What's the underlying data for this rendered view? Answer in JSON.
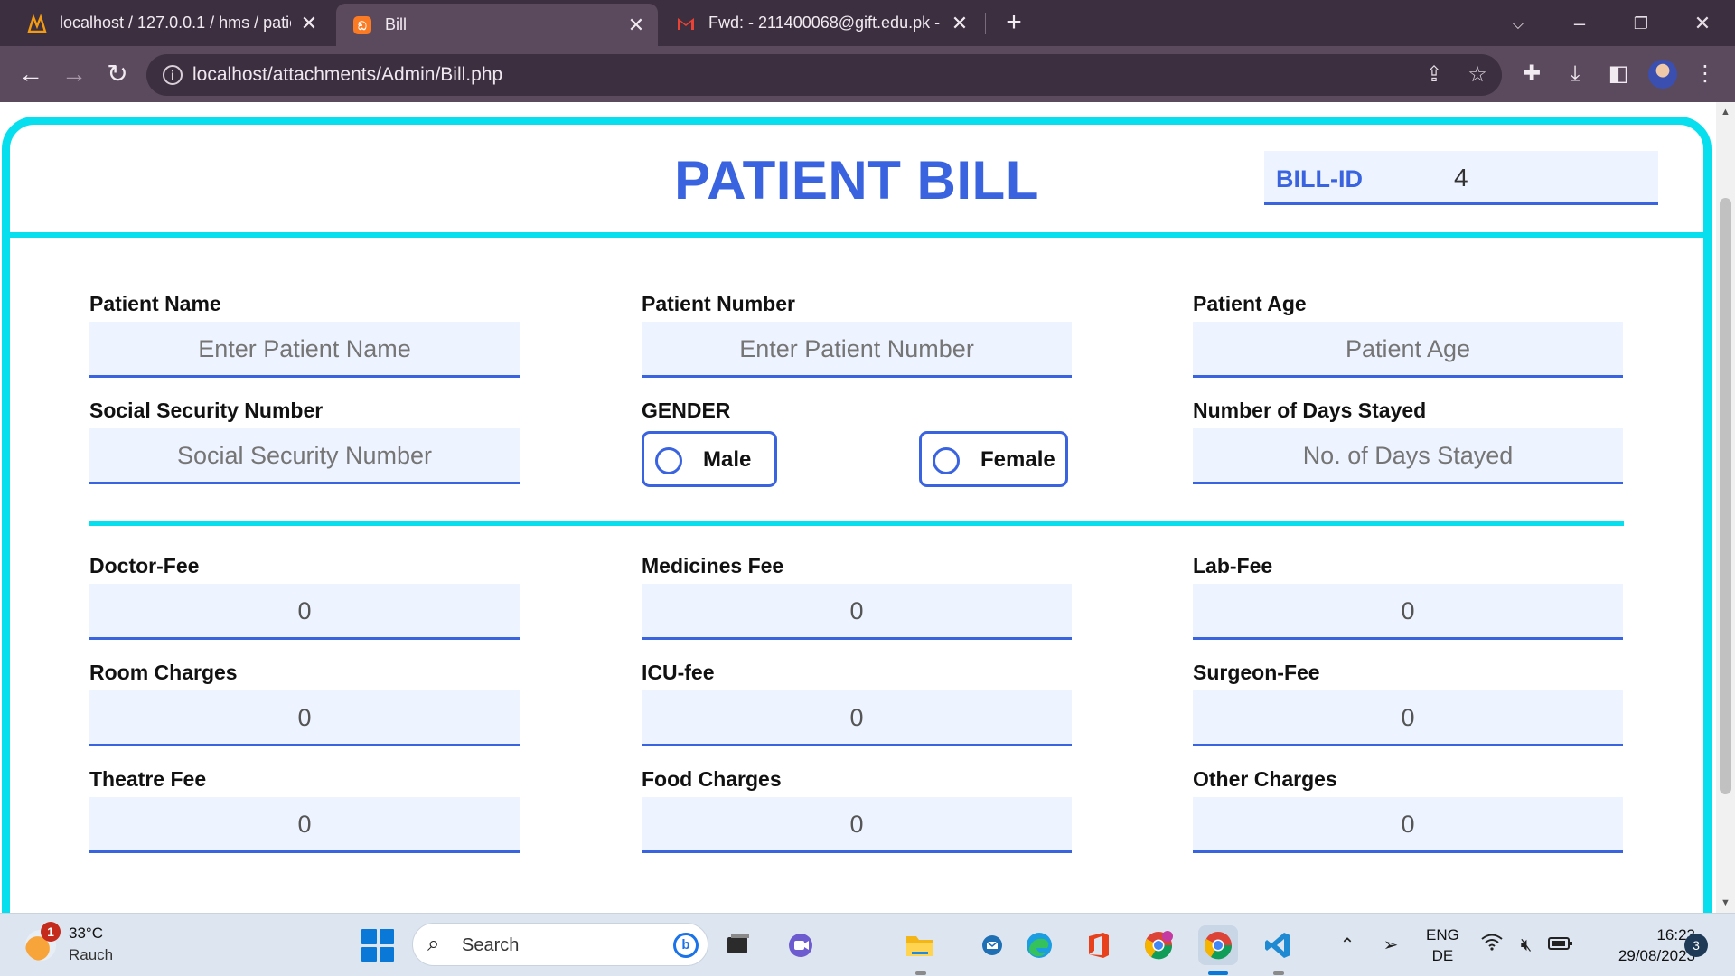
{
  "browser": {
    "tabs": [
      {
        "title": "localhost / 127.0.0.1 / hms / patie",
        "icon": "phpmyadmin-icon",
        "active": false
      },
      {
        "title": "Bill",
        "icon": "xampp-icon",
        "active": true
      },
      {
        "title": "Fwd: - 211400068@gift.edu.pk - ",
        "icon": "gmail-icon",
        "active": false
      }
    ],
    "url": "localhost/attachments/Admin/Bill.php"
  },
  "page": {
    "title": "PATIENT BILL",
    "bill_id": {
      "label": "BILL-ID",
      "value": "4"
    },
    "patient": {
      "name": {
        "label": "Patient Name",
        "placeholder": "Enter Patient Name"
      },
      "number": {
        "label": "Patient Number",
        "placeholder": "Enter Patient Number"
      },
      "age": {
        "label": "Patient Age",
        "placeholder": "Patient Age"
      },
      "ssn": {
        "label": "Social Security Number",
        "placeholder": "Social Security Number"
      },
      "gender": {
        "label": "GENDER",
        "options": [
          "Male",
          "Female"
        ],
        "selected": null
      },
      "days": {
        "label": "Number of Days Stayed",
        "placeholder": "No. of Days Stayed"
      }
    },
    "fees": {
      "doctor": {
        "label": "Doctor-Fee",
        "value": "0"
      },
      "medicines": {
        "label": "Medicines Fee",
        "value": "0"
      },
      "lab": {
        "label": "Lab-Fee",
        "value": "0"
      },
      "room": {
        "label": "Room Charges",
        "value": "0"
      },
      "icu": {
        "label": "ICU-fee",
        "value": "0"
      },
      "surgeon": {
        "label": "Surgeon-Fee",
        "value": "0"
      },
      "theatre": {
        "label": "Theatre Fee",
        "value": "0"
      },
      "food": {
        "label": "Food Charges",
        "value": "0"
      },
      "other": {
        "label": "Other Charges",
        "value": "0"
      }
    },
    "colors": {
      "accent": "#3a63e0",
      "frame": "#08dfee",
      "field_bg": "#eef4ff"
    }
  },
  "taskbar": {
    "weather": {
      "temp": "33°C",
      "desc": "Rauch",
      "badge": "1"
    },
    "search_label": "Search",
    "apps": [
      "windows-start-icon",
      "file-explorer-icon",
      "teams-icon",
      "file-manager-icon",
      "mail-icon",
      "edge-icon",
      "office-icon",
      "chrome-profile-icon",
      "chrome-icon",
      "vscode-icon"
    ],
    "language": {
      "line1": "ENG",
      "line2": "DE"
    },
    "clock": {
      "time": "16:23",
      "date": "29/08/2023"
    },
    "notifications": "3"
  }
}
